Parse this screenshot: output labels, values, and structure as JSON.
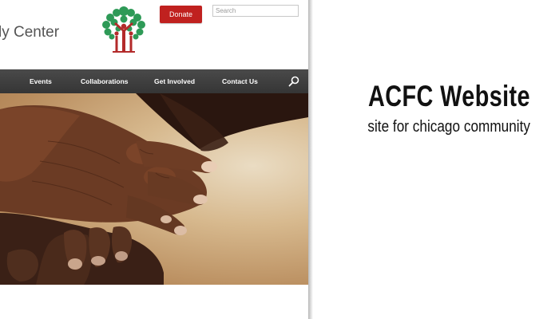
{
  "site": {
    "brand_partial": "ly Center",
    "donate_label": "Donate",
    "search_placeholder": "Search",
    "nav": {
      "items": [
        "Events",
        "Collaborations",
        "Get Involved",
        "Contact Us"
      ],
      "search_icon": "magnifier-icon"
    },
    "logo_icon": "family-tree-icon",
    "hero_image": "clasped-hands-photo"
  },
  "caption": {
    "title": "ACFC Website",
    "subtitle": "site for chicago community"
  },
  "colors": {
    "donate": "#c0211f",
    "nav_bar": "#3d3d3d",
    "logo_green": "#2e9a57",
    "logo_red": "#b32a2a"
  }
}
